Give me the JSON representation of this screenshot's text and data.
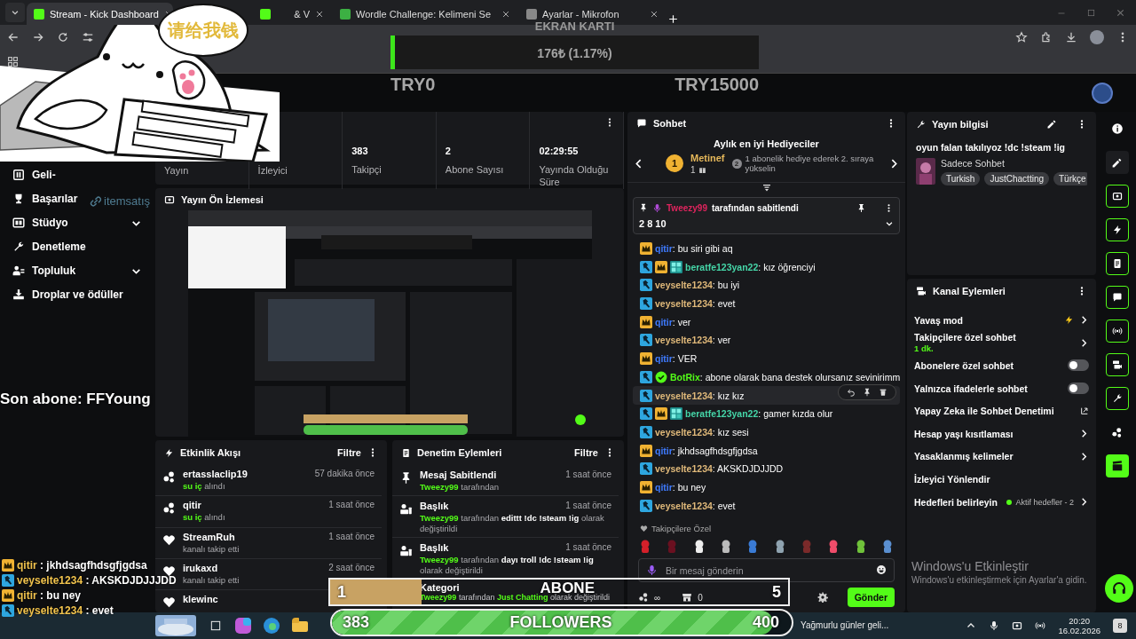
{
  "browser": {
    "tabs": [
      {
        "title": "Stream - Kick Dashboard",
        "selected": true
      },
      {
        "title": "& V",
        "selected": false
      },
      {
        "title": "Wordle Challenge: Kelimeni Se",
        "selected": false
      },
      {
        "title": "Ayarlar - Mikrofon",
        "selected": false
      }
    ]
  },
  "sidebar": {
    "items": [
      {
        "kind": "money",
        "label": "Geli-",
        "expandable": false
      },
      {
        "kind": "trophy",
        "label": "Başarılar",
        "expandable": false
      },
      {
        "kind": "studio",
        "label": "Stüdyo",
        "expandable": true
      },
      {
        "kind": "wrench",
        "label": "Denetleme",
        "expandable": false
      },
      {
        "kind": "users",
        "label": "Topluluk",
        "expandable": true
      },
      {
        "kind": "drop",
        "label": "Droplar ve ödüller",
        "expandable": false
      }
    ]
  },
  "stats": [
    {
      "label": "Yayın"
    },
    {
      "label": "İzleyici"
    },
    {
      "value": "383",
      "label": "Takipçi"
    },
    {
      "value": "2",
      "label": "Abone Sayısı"
    },
    {
      "value": "02:29:55",
      "label": "Yayında Olduğu Süre"
    }
  ],
  "preview": {
    "title": "Yayın Ön İzlemesi",
    "kind": "picture"
  },
  "activity": {
    "title": "Etkinlik Akışı",
    "filter": "Filtre",
    "items": [
      {
        "kind": "points",
        "user": "ertasslaclip19",
        "time": "57 dakika önce",
        "reward": "su iç",
        "action": "alındı"
      },
      {
        "kind": "points",
        "user": "qitir",
        "time": "1 saat önce",
        "reward": "su iç",
        "action": "alındı"
      },
      {
        "kind": "follow",
        "user": "StreamRuh",
        "time": "1 saat önce",
        "action": "kanalı takip etti"
      },
      {
        "kind": "follow",
        "user": "irukaxd",
        "time": "2 saat önce",
        "action": "kanalı takip etti"
      },
      {
        "kind": "follow",
        "user": "klewinc"
      }
    ]
  },
  "moderation": {
    "title": "Denetim Eylemleri",
    "filter": "Filtre",
    "items": [
      {
        "kind": "pin",
        "title": "Mesaj Sabitlendi",
        "time": "1 saat önce",
        "actor": "Tweezy99",
        "before": "tarafından"
      },
      {
        "kind": "title",
        "title": "Başlık",
        "time": "1 saat önce",
        "actor": "Tweezy99",
        "before": "tarafından",
        "value": "edittt !dc !steam !ig",
        "after": "olarak değiştirildi"
      },
      {
        "kind": "title",
        "title": "Başlık",
        "time": "1 saat önce",
        "actor": "Tweezy99",
        "before": "tarafından",
        "value": "dayı troll !dc !steam !ig",
        "after": "olarak değiştirildi"
      },
      {
        "kind": "category",
        "title": "Kategori",
        "actor": "Tweezy99",
        "before": "tarafından",
        "value": "Just Chatting",
        "after": "olarak değiştirildi"
      }
    ]
  },
  "chat": {
    "title": "Sohbet",
    "gifters": {
      "title": "Aylık en iyi Hediyeciler",
      "rank": "1",
      "name": "Metinef",
      "gifts": "1",
      "next_rank": "2",
      "hint": "1 abonelik hediye ederek 2. sıraya yükselin"
    },
    "pinned": {
      "by": "Tweezy99",
      "label": "tarafından sabitlendi",
      "text": "2 8 10"
    },
    "messages": [
      {
        "user": "qitir",
        "color": "#3f7bff",
        "mod": false,
        "vip": true,
        "og": false,
        "verified": false,
        "text": ": bu siri gibi aq",
        "highlighted": false
      },
      {
        "user": "beratfe123yan22",
        "color": "#45d6a8",
        "mod": true,
        "vip": true,
        "og": true,
        "verified": false,
        "text": ": kız öğrenciyi",
        "highlighted": false
      },
      {
        "user": "veyselte1234",
        "color": "#e0b97a",
        "mod": true,
        "vip": false,
        "og": false,
        "verified": false,
        "text": ": bu iyi",
        "highlighted": false
      },
      {
        "user": "veyselte1234",
        "color": "#e0b97a",
        "mod": true,
        "vip": false,
        "og": false,
        "verified": false,
        "text": ": evet",
        "highlighted": false
      },
      {
        "user": "qitir",
        "color": "#3f7bff",
        "mod": false,
        "vip": true,
        "og": false,
        "verified": false,
        "text": ": ver",
        "highlighted": false
      },
      {
        "user": "veyselte1234",
        "color": "#e0b97a",
        "mod": true,
        "vip": false,
        "og": false,
        "verified": false,
        "text": ": ver",
        "highlighted": false
      },
      {
        "user": "qitir",
        "color": "#3f7bff",
        "mod": false,
        "vip": true,
        "og": false,
        "verified": false,
        "text": ": VER",
        "highlighted": false
      },
      {
        "user": "BotRix",
        "color": "#53fc18",
        "mod": true,
        "vip": false,
        "og": false,
        "verified": true,
        "text": ": abone olarak bana destek olursanız sevinirimm",
        "highlighted": false
      },
      {
        "user": "veyselte1234",
        "color": "#e0b97a",
        "mod": true,
        "vip": false,
        "og": false,
        "verified": false,
        "text": ": kız kız",
        "highlighted": true
      },
      {
        "user": "beratfe123yan22",
        "color": "#45d6a8",
        "mod": true,
        "vip": true,
        "og": true,
        "verified": false,
        "text": ": gamer kızda olur",
        "highlighted": false
      },
      {
        "user": "veyselte1234",
        "color": "#e0b97a",
        "mod": true,
        "vip": false,
        "og": false,
        "verified": false,
        "text": ": kız sesi",
        "highlighted": false
      },
      {
        "user": "qitir",
        "color": "#3f7bff",
        "mod": false,
        "vip": true,
        "og": false,
        "verified": false,
        "text": ": jkhdsagfhdsgfjgdsa",
        "highlighted": false
      },
      {
        "user": "veyselte1234",
        "color": "#e0b97a",
        "mod": true,
        "vip": false,
        "og": false,
        "verified": false,
        "text": ": AKSKDJDJJDD",
        "highlighted": false
      },
      {
        "user": "qitir",
        "color": "#3f7bff",
        "mod": false,
        "vip": true,
        "og": false,
        "verified": false,
        "text": ": bu ney",
        "highlighted": false
      },
      {
        "user": "veyselte1234",
        "color": "#e0b97a",
        "mod": true,
        "vip": false,
        "og": false,
        "verified": false,
        "text": ": evet",
        "highlighted": false
      }
    ],
    "emotes_label": "Takipçilere Özel",
    "placeholder": "Bir mesaj gönderin",
    "points": "∞",
    "shop": "0",
    "send": "Gönder"
  },
  "stream_info": {
    "title": "Yayın bilgisi",
    "stream_title": "oyun falan takılıyoz !dc !steam !ig",
    "category": "Sadece Sohbet",
    "tags": [
      "Turkish",
      "JustChactting",
      "Türkçe"
    ]
  },
  "channel_actions": {
    "title": "Kanal Eylemleri",
    "items": [
      {
        "kind": "bolt",
        "label": "Yavaş mod"
      },
      {
        "kind": "arrow",
        "label": "Takipçilere özel sohbet",
        "note": "1 dk."
      },
      {
        "kind": "toggle",
        "label": "Abonelere özel sohbet",
        "on": false
      },
      {
        "kind": "toggle",
        "label": "Yalnızca ifadelerle sohbet",
        "on": false
      },
      {
        "kind": "external",
        "label": "Yapay Zeka ile Sohbet Denetimi"
      },
      {
        "kind": "arrow",
        "label": "Hesap yaşı kısıtlaması"
      },
      {
        "kind": "arrow",
        "label": "Yasaklanmış kelimeler"
      },
      {
        "kind": "plain",
        "label": "İzleyici Yönlendir"
      },
      {
        "kind": "goal",
        "label": "Hedefleri belirleyin",
        "note": "Aktif hedefler - 2"
      }
    ]
  },
  "overlays": {
    "speech": "请给我钱",
    "sponsor": "itemsatış",
    "donation_goal": {
      "title": "EKRAN KARTI",
      "amount": "176₺ (1.17%)",
      "level": 0.0117,
      "min": "TRY0",
      "max": "TRY15000"
    },
    "last_sub": "Son abone: FFYoung",
    "chat_lines": [
      {
        "user": "qitir",
        "kind": "vip",
        "text": ": jkhdsagfhdsgfjgdsa"
      },
      {
        "user": "veyselte1234",
        "kind": "mod",
        "text": ": AKSKDJDJJJDD"
      },
      {
        "user": "qitir",
        "kind": "vip",
        "text": ": bu ney"
      },
      {
        "user": "veyselte1234",
        "kind": "mod",
        "text": ": evet"
      }
    ],
    "sub_goal": {
      "current": "1",
      "label": "ABONE",
      "target": "5",
      "level": 0.2
    },
    "follower_goal": {
      "current": "383",
      "label": "FOLLOWERS",
      "target": "400",
      "level": 0.96
    }
  },
  "windows_notice": {
    "title": "Windows'u Etkinleştir",
    "text": "Windows'u etkinleştirmek için Ayarlar'a gidin."
  },
  "taskbar": {
    "weather": "Yağmurlu günler geli...",
    "time": "20:20",
    "date": "16.02.2026",
    "notifications": "8"
  }
}
